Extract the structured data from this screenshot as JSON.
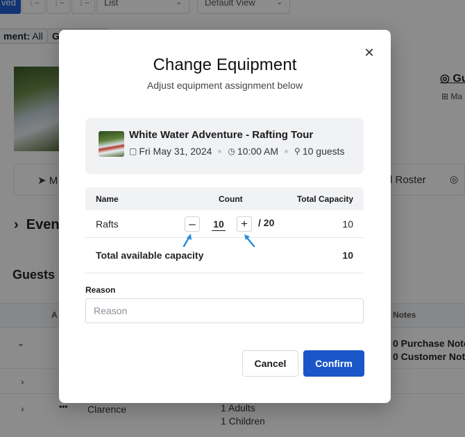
{
  "background": {
    "toolbar": {
      "active_button": "ved",
      "view_select": "List",
      "default_view": "Default View"
    },
    "filters": [
      {
        "label": "ment:",
        "value": "All"
      },
      {
        "label": "G",
        "value": ""
      }
    ],
    "right_link": "Gu",
    "right_sub": "Ma",
    "action_items": [
      {
        "label": "M"
      },
      {
        "label": "l Roster"
      }
    ],
    "events_section": "Even",
    "guests_section": "Guests",
    "table_headers": {
      "a": "A",
      "notes": "Notes"
    },
    "notes_lines": [
      "0 Purchase Note",
      "0 Customer Note"
    ],
    "guest_row": {
      "name": "Clarence",
      "adults": "1 Adults",
      "children": "1 Children",
      "more": "•••"
    }
  },
  "modal": {
    "title": "Change Equipment",
    "subtitle": "Adjust equipment assignment below",
    "close_icon": "close-icon",
    "event": {
      "name": "White Water Adventure - Rafting Tour",
      "date": "Fri May 31, 2024",
      "time": "10:00 AM",
      "guests": "10 guests"
    },
    "table": {
      "headers": {
        "name": "Name",
        "count": "Count",
        "capacity": "Total Capacity"
      },
      "rows": [
        {
          "name": "Rafts",
          "count": "10",
          "max": "/ 20",
          "capacity": "10"
        }
      ],
      "total_label": "Total available capacity",
      "total_value": "10"
    },
    "reason": {
      "label": "Reason",
      "placeholder": "Reason",
      "value": ""
    },
    "buttons": {
      "cancel": "Cancel",
      "confirm": "Confirm"
    },
    "colors": {
      "primary": "#1a55c9",
      "annotation": "#2b8fd8"
    }
  }
}
